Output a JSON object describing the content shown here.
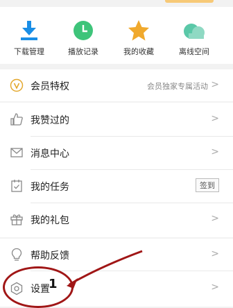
{
  "quick": [
    {
      "label": "下载管理",
      "icon": "download-icon",
      "color": "#1a8ee6"
    },
    {
      "label": "播放记录",
      "icon": "clock-icon",
      "color": "#3ec47a"
    },
    {
      "label": "我的收藏",
      "icon": "star-icon",
      "color": "#f0a92d"
    },
    {
      "label": "离线空间",
      "icon": "cloud-icon",
      "color": "#5ac8a8"
    }
  ],
  "vip": {
    "label": "会员特权",
    "sub": "会员独家专属活动",
    "icon": "vip-badge-icon"
  },
  "menu": [
    {
      "label": "我赞过的",
      "icon": "thumbs-up-icon"
    },
    {
      "label": "消息中心",
      "icon": "mail-icon"
    },
    {
      "label": "我的任务",
      "icon": "task-icon",
      "badge": "签到"
    },
    {
      "label": "我的礼包",
      "icon": "gift-icon"
    }
  ],
  "bottom": [
    {
      "label": "帮助反馈",
      "icon": "lightbulb-icon"
    },
    {
      "label": "设置",
      "icon": "settings-icon"
    }
  ],
  "chevron": ">",
  "annotation": {
    "number": "1",
    "color": "#a01616"
  }
}
